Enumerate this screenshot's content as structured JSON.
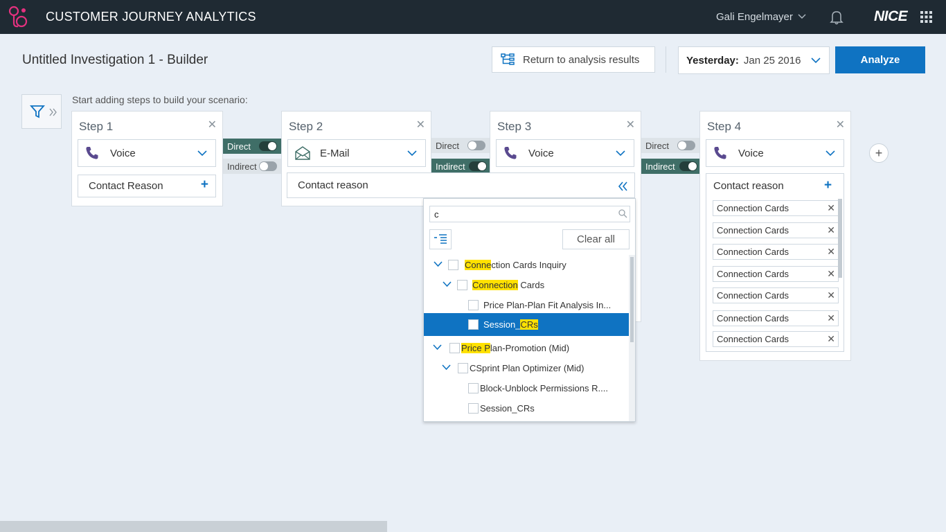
{
  "app": {
    "title": "CUSTOMER JOURNEY ANALYTICS",
    "user": "Gali Engelmayer",
    "brand": "NICE"
  },
  "header": {
    "page_title": "Untitled Investigation 1 - Builder",
    "return_label": "Return to analysis results",
    "date_label": "Yesterday:",
    "date_value": "Jan 25 2016",
    "analyze_label": "Analyze"
  },
  "hint": "Start adding steps to build your scenario:",
  "steps": [
    {
      "title": "Step 1",
      "channel": "Voice",
      "reason": "Contact Reason"
    },
    {
      "title": "Step 2",
      "channel": "E-Mail",
      "reason": "Contact reason"
    },
    {
      "title": "Step 3",
      "channel": "Voice"
    },
    {
      "title": "Step 4",
      "channel": "Voice",
      "reason": "Contact reason"
    }
  ],
  "connectors": [
    {
      "direct": "Direct",
      "indirect": "Indirect",
      "mode": "direct"
    },
    {
      "direct": "Direct",
      "indirect": "Indirect",
      "mode": "indirect"
    },
    {
      "direct": "Direct",
      "indirect": "Indirect",
      "mode": "indirect"
    }
  ],
  "dropdown": {
    "search_value": "c",
    "clear_label": "Clear all",
    "tree": [
      {
        "level": 0,
        "hl": "Conne",
        "rest": "ction Cards Inquiry",
        "expandable": true
      },
      {
        "level": 1,
        "hl": "Connection",
        "rest": " Cards",
        "expandable": true
      },
      {
        "level": 2,
        "pre": "Price Plan-Plan Fit Analysis In...",
        "expandable": false
      },
      {
        "level": 2,
        "pre": "Session_",
        "hl": "CRs",
        "expandable": false,
        "selected": true
      },
      {
        "level": 0,
        "hl": "Price P",
        "rest": "lan-Promotion (Mid)",
        "expandable": true
      },
      {
        "level": 1,
        "pre": "CSprint Plan Optimizer (Mid)",
        "expandable": true
      },
      {
        "level": 2,
        "pre": "Block-Unblock Permissions R....",
        "expandable": false
      },
      {
        "level": 2,
        "pre": "Session_CRs",
        "expandable": false
      }
    ]
  },
  "step4_tags": [
    "Connection Cards",
    "Connection Cards",
    "Connection Cards",
    "Connection Cards",
    "Connection Cards",
    "Connection Cards",
    "Connection Cards"
  ],
  "colors": {
    "topbar": "#1f2a33",
    "accent": "#0f73c2",
    "connector_on": "#3f6e67",
    "highlight": "#ffe100",
    "logo": "#e4317f"
  }
}
